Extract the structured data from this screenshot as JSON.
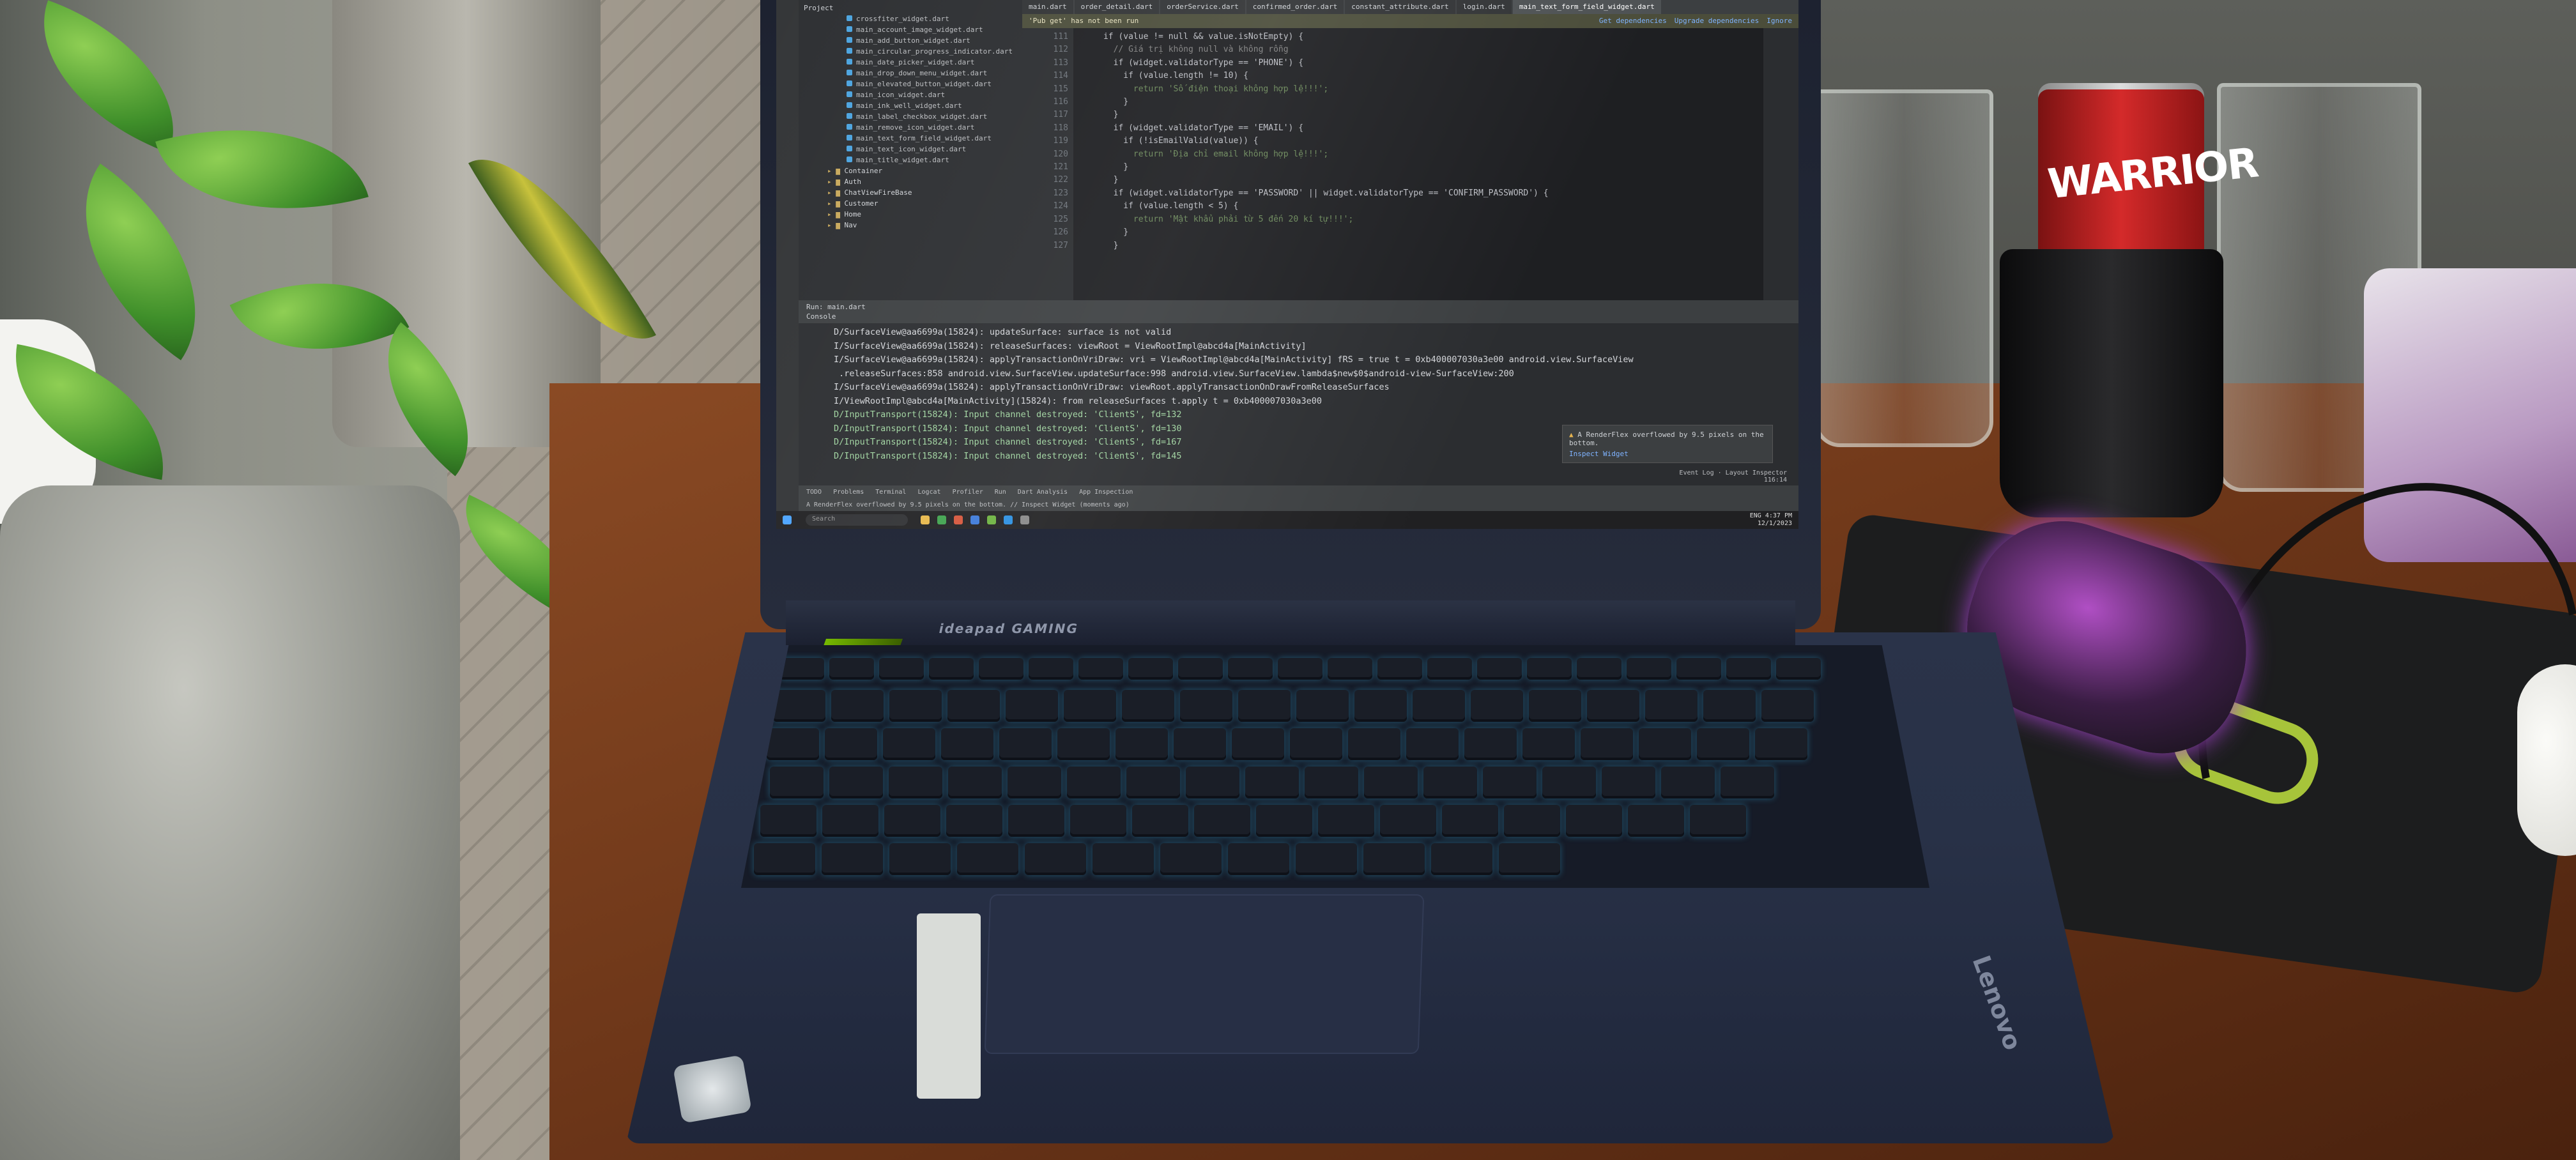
{
  "tabs": [
    "main.dart",
    "order_detail.dart",
    "orderService.dart",
    "confirmed_order.dart",
    "constant_attribute.dart",
    "login.dart",
    "main_text_form_field_widget.dart"
  ],
  "banner": {
    "message": "'Pub get' has not been run",
    "links": [
      "Get dependencies",
      "Upgrade dependencies",
      "Ignore"
    ]
  },
  "project": {
    "header": "Project",
    "files": [
      "crossfiter_widget.dart",
      "main_account_image_widget.dart",
      "main_add_button_widget.dart",
      "main_circular_progress_indicator.dart",
      "main_date_picker_widget.dart",
      "main_drop_down_menu_widget.dart",
      "main_elevated_button_widget.dart",
      "main_icon_widget.dart",
      "main_ink_well_widget.dart",
      "main_label_checkbox_widget.dart",
      "main_remove_icon_widget.dart",
      "main_text_form_field_widget.dart",
      "main_text_icon_widget.dart",
      "main_title_widget.dart"
    ],
    "folders": [
      "Container",
      "Auth",
      "ChatViewFireBase",
      "Customer",
      "Home",
      "Nav"
    ]
  },
  "editor": {
    "lines": [
      "111",
      "112",
      "113",
      "114",
      "115",
      "116",
      "117",
      "118",
      "119",
      "120",
      "121",
      "122",
      "123",
      "124",
      "125",
      "126",
      "127"
    ],
    "code": [
      "      if (value != null && value.isNotEmpty) {",
      "        // Giá trị không null và không rỗng",
      "        if (widget.validatorType == 'PHONE') {",
      "          if (value.length != 10) {",
      "            return 'Số điện thoại không hợp lệ!!!';",
      "          }",
      "        }",
      "        if (widget.validatorType == 'EMAIL') {",
      "          if (!isEmailValid(value)) {",
      "            return 'Địa chỉ email không hợp lệ!!!';",
      "          }",
      "        }",
      "        if (widget.validatorType == 'PASSWORD' || widget.validatorType == 'CONFIRM_PASSWORD') {",
      "          if (value.length < 5) {",
      "            return 'Mật khẩu phải từ 5 đến 20 kí tự!!!';",
      "          }",
      "        }"
    ]
  },
  "run": {
    "label": "Run:",
    "config": "main.dart",
    "console_tab": "Console"
  },
  "console": [
    "D/SurfaceView@aa6699a(15824): updateSurface: surface is not valid",
    "I/SurfaceView@aa6699a(15824): releaseSurfaces: viewRoot = ViewRootImpl@abcd4a[MainActivity]",
    "I/SurfaceView@aa6699a(15824): applyTransactionOnVriDraw: vri = ViewRootImpl@abcd4a[MainActivity] fRS = true t = 0xb400007030a3e00 android.view.SurfaceView",
    " .releaseSurfaces:858 android.view.SurfaceView.updateSurface:998 android.view.SurfaceView.lambda$new$0$android-view-SurfaceView:200",
    "I/SurfaceView@aa6699a(15824): applyTransactionOnVriDraw: viewRoot.applyTransactionOnDrawFromReleaseSurfaces",
    "I/ViewRootImpl@abcd4a[MainActivity](15824): from releaseSurfaces t.apply t = 0xb400007030a3e00",
    "D/InputTransport(15824): Input channel destroyed: 'ClientS', fd=132",
    "D/InputTransport(15824): Input channel destroyed: 'ClientS', fd=130",
    "D/InputTransport(15824): Input channel destroyed: 'ClientS', fd=167",
    "D/InputTransport(15824): Input channel destroyed: 'ClientS', fd=145"
  ],
  "popup": {
    "message": "A RenderFlex overflowed by 9.5 pixels on the bottom.",
    "link": "Inspect Widget"
  },
  "status_right": {
    "event_log": "Event Log",
    "layout_inspector": "Layout Inspector",
    "position": "116:14"
  },
  "bottom_tabs": [
    "TODO",
    "Problems",
    "Terminal",
    "Logcat",
    "Profiler",
    "Run",
    "Dart Analysis",
    "App Inspection"
  ],
  "statusbar": "A RenderFlex overflowed by 9.5 pixels on the bottom. // Inspect Widget (moments ago)",
  "taskbar": {
    "search": "Search",
    "lang": "ENG",
    "time": "4:37 PM",
    "date": "12/1/2023"
  },
  "laptop": {
    "brand": "ideapad GAMING",
    "logo": "Lenovo"
  },
  "can_text": "WARRIOR",
  "colors": {
    "ide_bg": "#1e1f22",
    "keyword": "#cc7832",
    "string": "#6a8759",
    "backlight": "#5fd6ff",
    "mouse_glow": "#a243c9"
  }
}
